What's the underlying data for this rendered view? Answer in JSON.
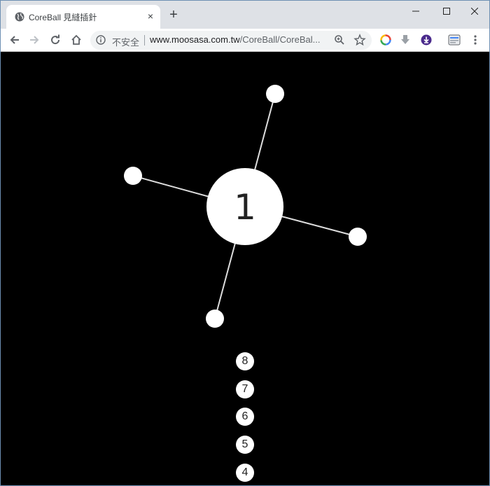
{
  "browser": {
    "tab_title": "CoreBall 見縫插針",
    "tab_close": "×",
    "new_tab": "+",
    "security_label": "不安全",
    "url_host": "www.moosasa.com.tw",
    "url_path": "/CoreBall/CoreBal...",
    "window_controls": {
      "minimize": "—",
      "maximize": "☐",
      "close": "✕"
    }
  },
  "game": {
    "core_number": "1",
    "pin_count": 4,
    "queue": [
      "8",
      "7",
      "6",
      "5",
      "4"
    ],
    "colors": {
      "background": "#000000",
      "ball": "#ffffff",
      "text": "#222222"
    }
  }
}
